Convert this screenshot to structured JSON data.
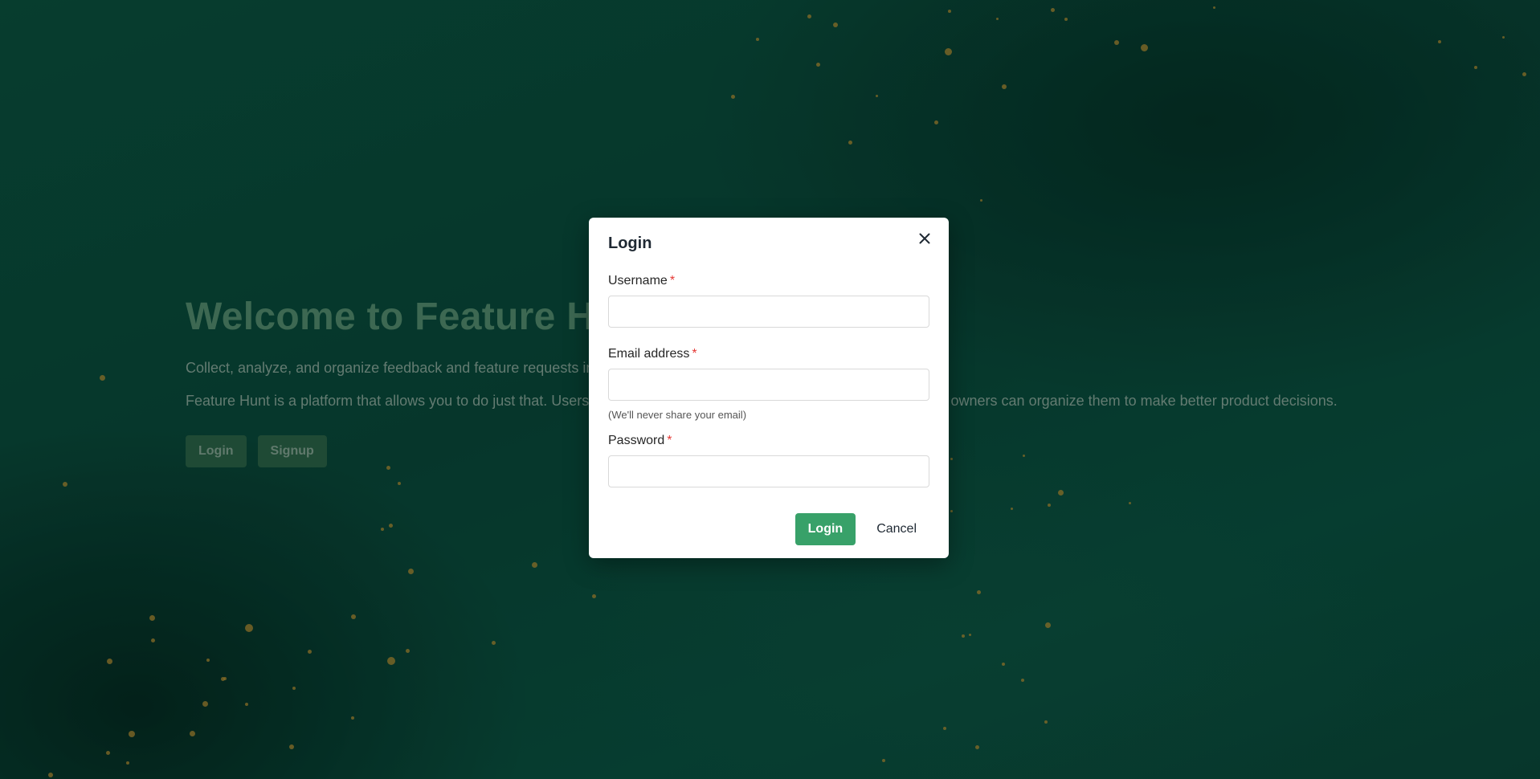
{
  "hero": {
    "title": "Welcome to Feature Hunt",
    "line1": "Collect, analyze, and organize feedback and feature requests in a single place to make better product decisions.",
    "line2": "Feature Hunt is a platform that allows you to do just that. Users can submit feature requests and feedback, and product owners can organize them to make better product decisions.",
    "login_label": "Login",
    "signup_label": "Signup"
  },
  "modal": {
    "title": "Login",
    "close_icon": "close-icon",
    "fields": {
      "username": {
        "label": "Username",
        "required_mark": "*",
        "value": ""
      },
      "email": {
        "label": "Email address",
        "required_mark": "*",
        "value": "",
        "hint": "(We'll never share your email)"
      },
      "password": {
        "label": "Password",
        "required_mark": "*",
        "value": ""
      }
    },
    "submit_label": "Login",
    "cancel_label": "Cancel"
  },
  "colors": {
    "primary_button": "#38a169",
    "required_mark": "#e53935",
    "speck": "#c9a03a"
  }
}
